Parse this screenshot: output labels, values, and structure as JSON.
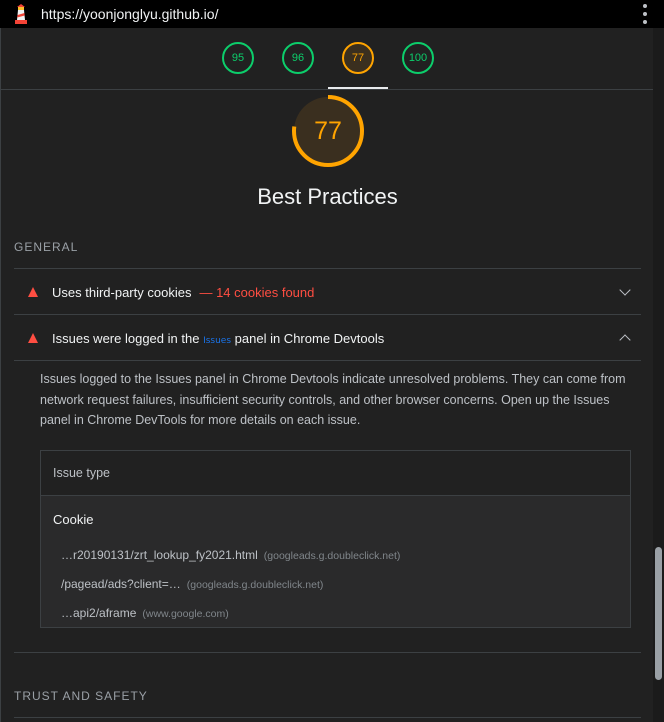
{
  "browser": {
    "url": "https://yoonjonglyu.github.io/",
    "menu_icon": "kebab-menu-icon",
    "logo_icon": "lighthouse-icon"
  },
  "score_tabs": [
    {
      "label": "95",
      "color": "#0cce6b"
    },
    {
      "label": "96",
      "color": "#0cce6b"
    },
    {
      "label": "77",
      "color": "#ffa400",
      "active": true
    },
    {
      "label": "100",
      "color": "#0cce6b"
    }
  ],
  "category": {
    "score": "77",
    "score_fraction": 0.77,
    "score_color": "#ffa400",
    "title": "Best Practices"
  },
  "groups": {
    "general": "GENERAL",
    "trust": "TRUST AND SAFETY"
  },
  "audits": [
    {
      "title": "Uses third-party cookies",
      "display_value": "— 14 cookies found",
      "expanded": false
    },
    {
      "title_pre": "Issues were logged in the",
      "title_keyword": "Issues",
      "title_post": "panel in Chrome Devtools",
      "expanded": true,
      "description": "Issues logged to the Issues panel in Chrome Devtools indicate unresolved problems. They can come from network request failures, insufficient security controls, and other browser concerns. Open up the Issues panel in Chrome DevTools for more details on each issue."
    }
  ],
  "issues_table": {
    "header": "Issue type",
    "group": "Cookie",
    "rows": [
      {
        "url": "…r20190131/zrt_lookup_fy2021.html",
        "host": "(googleads.g.doubleclick.net)"
      },
      {
        "url": "/pagead/ads?client=…",
        "host": "(googleads.g.doubleclick.net)"
      },
      {
        "url": "…api2/aframe",
        "host": "(www.google.com)"
      }
    ]
  },
  "colors": {
    "pass": "#0cce6b",
    "average": "#ffa400",
    "fail": "#ff4e42",
    "background": "#212121"
  }
}
